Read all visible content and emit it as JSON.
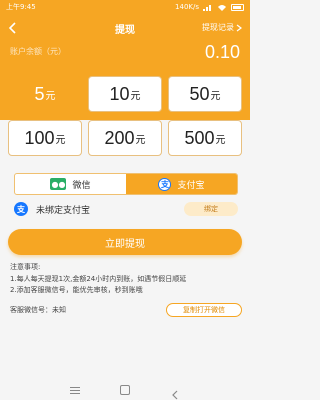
{
  "status_bar": {
    "time": "上午9:45",
    "network": "140K/s",
    "battery_icon": "battery-icon",
    "signal_icon": "signal-icon",
    "wifi_icon": "wifi-icon"
  },
  "nav": {
    "title": "提现",
    "record_label": "提现记录",
    "back_icon": "back-arrow-icon"
  },
  "balance": {
    "label": "账户余额（元）",
    "value": "0.10"
  },
  "amounts": [
    {
      "value": "5",
      "unit": "元",
      "selected": true
    },
    {
      "value": "10",
      "unit": "元",
      "selected": false
    },
    {
      "value": "50",
      "unit": "元",
      "selected": false
    },
    {
      "value": "100",
      "unit": "元",
      "selected": false
    },
    {
      "value": "200",
      "unit": "元",
      "selected": false
    },
    {
      "value": "500",
      "unit": "元",
      "selected": false
    }
  ],
  "pay_methods": [
    {
      "label": "微信",
      "icon": "wechat-icon",
      "active": false
    },
    {
      "label": "支付宝",
      "icon": "alipay-icon",
      "active": true
    }
  ],
  "bind": {
    "text": "未绑定支付宝",
    "button": "绑定"
  },
  "withdraw_button": "立即提现",
  "notes": {
    "title": "注意事项:",
    "items": [
      "1.每人每天提现1次,金额24小时内到账，如遇节假日顺延",
      "2.添加客服微信号，能优先审核，秒到账哦"
    ]
  },
  "service": {
    "label": "客服微信号：未知",
    "copy_button": "复制打开微信"
  },
  "colors": {
    "accent": "#f6a623",
    "wechat": "#2aae67",
    "alipay": "#1677ff"
  }
}
